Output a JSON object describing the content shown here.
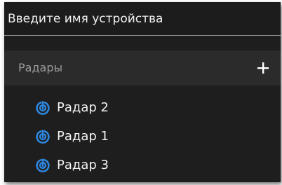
{
  "search": {
    "placeholder": "Введите имя устройства"
  },
  "group": {
    "title": "Радары",
    "add_icon": "plus-icon"
  },
  "devices": [
    {
      "name": "Радар 2",
      "icon": "radar-icon"
    },
    {
      "name": "Радар 1",
      "icon": "radar-icon"
    },
    {
      "name": "Радар 3",
      "icon": "radar-icon"
    }
  ],
  "colors": {
    "panel_background": "#1e1e1e",
    "group_header_background": "#2b2b2b",
    "text": "#f2f2f2",
    "muted_text": "#9a9a9a",
    "accent": "#2e86de"
  }
}
